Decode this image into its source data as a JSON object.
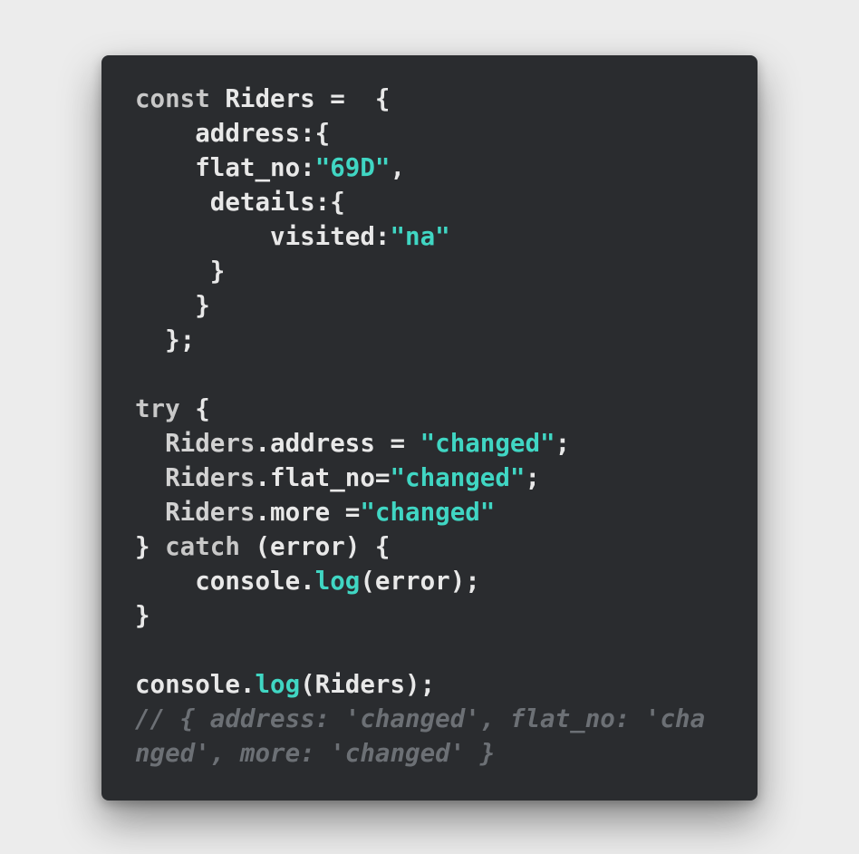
{
  "code_lines": [
    [
      {
        "t": "const ",
        "c": "kw"
      },
      {
        "t": "Riders",
        "c": "id"
      },
      {
        "t": " =  {",
        "c": "punc"
      }
    ],
    [
      {
        "t": "    address:{",
        "c": "id"
      }
    ],
    [
      {
        "t": "    flat_no:",
        "c": "id"
      },
      {
        "t": "\"69D\"",
        "c": "str"
      },
      {
        "t": ",",
        "c": "punc"
      }
    ],
    [
      {
        "t": "     details:{",
        "c": "id"
      }
    ],
    [
      {
        "t": "         visited:",
        "c": "id"
      },
      {
        "t": "\"na\"",
        "c": "str"
      }
    ],
    [
      {
        "t": "     }",
        "c": "punc"
      }
    ],
    [
      {
        "t": "    }",
        "c": "punc"
      }
    ],
    [
      {
        "t": "  };",
        "c": "punc"
      }
    ],
    [],
    [
      {
        "t": "try",
        "c": "kw"
      },
      {
        "t": " {",
        "c": "punc"
      }
    ],
    [
      {
        "t": "  Riders",
        "c": "var"
      },
      {
        "t": ".address = ",
        "c": "id"
      },
      {
        "t": "\"changed\"",
        "c": "str"
      },
      {
        "t": ";",
        "c": "punc"
      }
    ],
    [
      {
        "t": "  Riders",
        "c": "var"
      },
      {
        "t": ".flat_no=",
        "c": "id"
      },
      {
        "t": "\"changed\"",
        "c": "str"
      },
      {
        "t": ";",
        "c": "punc"
      }
    ],
    [
      {
        "t": "  Riders",
        "c": "var"
      },
      {
        "t": ".more =",
        "c": "id"
      },
      {
        "t": "\"changed\"",
        "c": "str"
      }
    ],
    [
      {
        "t": "} ",
        "c": "punc"
      },
      {
        "t": "catch",
        "c": "kw"
      },
      {
        "t": " (error) {",
        "c": "id"
      }
    ],
    [
      {
        "t": "    console.",
        "c": "id"
      },
      {
        "t": "log",
        "c": "fn"
      },
      {
        "t": "(error);",
        "c": "id"
      }
    ],
    [
      {
        "t": "}",
        "c": "punc"
      }
    ],
    [],
    [
      {
        "t": "console.",
        "c": "id"
      },
      {
        "t": "log",
        "c": "fn"
      },
      {
        "t": "(Riders);",
        "c": "id"
      }
    ],
    [
      {
        "t": "// { address: 'changed', flat_no: 'cha",
        "c": "cmt"
      }
    ],
    [
      {
        "t": "nged', more: 'changed' }",
        "c": "cmt"
      }
    ]
  ],
  "colors": {
    "background": "#ececec",
    "card": "#2a2c2f",
    "text": "#e8e8e8",
    "keyword": "#c8c8c8",
    "string": "#40d6c3",
    "function": "#40d6c3",
    "comment": "#6c7075"
  }
}
